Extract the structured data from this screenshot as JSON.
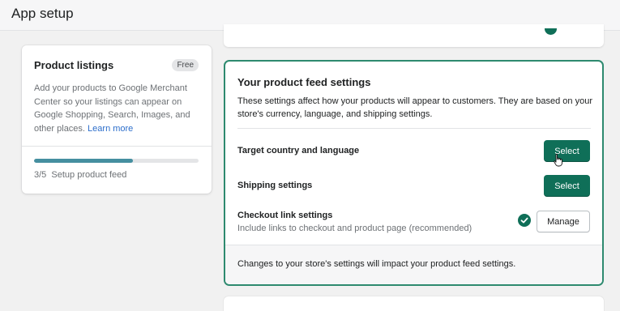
{
  "header": {
    "title": "App setup"
  },
  "product_listings": {
    "title": "Product listings",
    "badge": "Free",
    "description": "Add your products to Google Merchant Center so your listings can appear on Google Shopping, Search, Images, and other places.",
    "learn_more": "Learn more",
    "progress_fraction": 0.6,
    "progress_text": "3/5  Setup product feed"
  },
  "feed_settings": {
    "title": "Your product feed settings",
    "description": "These settings affect how your products will appear to customers. They are based on your store's currency, language, and shipping settings.",
    "rows": [
      {
        "label": "Target country and language",
        "button": "Select"
      },
      {
        "label": "Shipping settings",
        "button": "Select"
      },
      {
        "label": "Checkout link settings",
        "sublabel": "Include links to checkout and product page (recommended)",
        "button": "Manage",
        "status": "complete"
      }
    ],
    "footer": "Changes to your store's settings will impact your product feed settings."
  },
  "colors": {
    "primary_button": "#0f6f58",
    "accent_border": "#2e8a6f",
    "progress": "#458fa0",
    "link": "#2c6ecb"
  },
  "icons": {
    "check": "check-circle-icon",
    "cursor": "pointer-cursor-icon"
  }
}
